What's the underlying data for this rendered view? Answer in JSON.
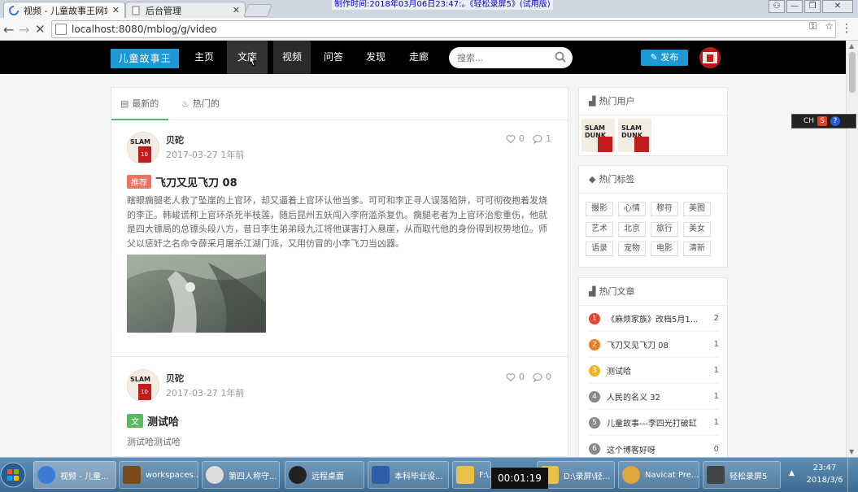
{
  "browser": {
    "tabs": [
      {
        "title": "视频 - 儿童故事王网站",
        "active": true
      },
      {
        "title": "后台管理",
        "active": false
      }
    ],
    "url": "localhost:8080/mblog/g/video",
    "recorder_banner": "制作时间:2018年03月06日23:47:。《轻松录屏5》(试用版)"
  },
  "header": {
    "logo": "儿童故事王",
    "nav": [
      "主页",
      "文库",
      "视频",
      "问答",
      "发现",
      "走廊"
    ],
    "search_placeholder": "搜索...",
    "publish_label": "发布"
  },
  "feed": {
    "tabs": [
      "最新的",
      "热门的"
    ],
    "posts": [
      {
        "author": "贝砣",
        "date": "2017-03-27",
        "relative": "1年前",
        "likes": "0",
        "comments": "1",
        "badge": "推荐",
        "title": "飞刀又见飞刀 08",
        "body": "瞎眼瘸腿老人救了坠崖的上官环，却又逼着上官环认他当爹。可可和李正寻人误落陷阱，可可彻夜抱着发烧的李正。韩峻谎称上官环杀死半枝莲，随后昆州五妖闯入李府滥杀复仇。瘸腿老者为上官环治愈重伤，他就是四大镖局的总镖头段八方，昔日李生弟弟段九江将他谋害打入悬崖，从而取代他的身份得到权势地位。师父以惩奸之名命令薛采月屠杀江湖门派，又用仿冒的小李飞刀当凶器。"
      },
      {
        "author": "贝砣",
        "date": "2017-03-27",
        "relative": "1年前",
        "likes": "0",
        "comments": "0",
        "badge": "文",
        "title": "测试哈",
        "body": "测试哈测试哈"
      }
    ]
  },
  "sidebar": {
    "hot_users_title": "热门用户",
    "hot_tags_title": "热门标签",
    "tags": [
      "摄影",
      "心情",
      "穆符",
      "美图",
      "艺术",
      "北京",
      "旅行",
      "美女",
      "语录",
      "宠物",
      "电影",
      "清新"
    ],
    "hot_articles_title": "热门文章",
    "articles": [
      {
        "rank": "1",
        "title": "《麻烦家族》改档5月1...",
        "count": "2",
        "color": "#e8442f"
      },
      {
        "rank": "2",
        "title": "飞刀又见飞刀 08",
        "count": "1",
        "color": "#ef7d22"
      },
      {
        "rank": "3",
        "title": "测试哈",
        "count": "1",
        "color": "#f3b51b"
      },
      {
        "rank": "4",
        "title": "人民的名义 32",
        "count": "1",
        "color": "#888888"
      },
      {
        "rank": "5",
        "title": "儿童故事---李四光打破缸",
        "count": "1",
        "color": "#888888"
      },
      {
        "rank": "6",
        "title": "这个博客好呀",
        "count": "0",
        "color": "#888888"
      }
    ]
  },
  "ime": {
    "label": "CH",
    "s": "S",
    "q": "?"
  },
  "taskbar": {
    "items": [
      {
        "label": "视频 - 儿童...",
        "color": "#3c7bd6"
      },
      {
        "label": "workspaces...",
        "color": "#7a4a1a"
      },
      {
        "label": "第四人称守...",
        "color": "#dcdcdc"
      },
      {
        "label": "远程桌面",
        "color": "#222222"
      },
      {
        "label": "本科毕业设...",
        "color": "#2f5ea8"
      },
      {
        "label": "F:\\...",
        "color": "#e7c14a"
      },
      {
        "label": "D:\\录屏\\轻...",
        "color": "#e7c14a"
      },
      {
        "label": "Navicat Pre...",
        "color": "#e0a83a"
      },
      {
        "label": "轻松录屏5",
        "color": "#444444"
      }
    ],
    "time": "23:47",
    "date": "2018/3/6",
    "recording_timer": "00:01:19"
  }
}
